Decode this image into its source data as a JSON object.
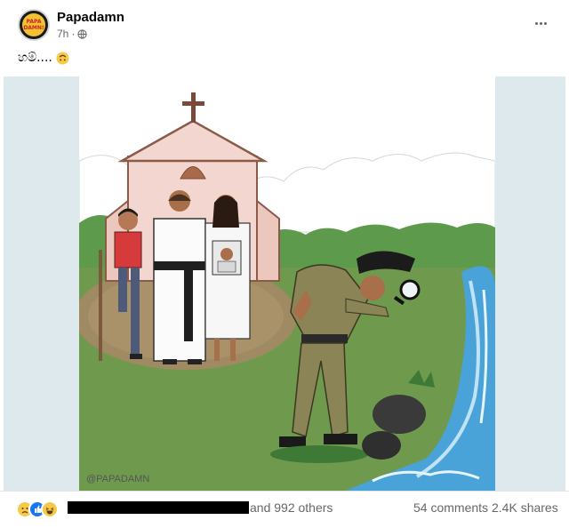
{
  "post": {
    "page_name": "Papadamn",
    "time": "7h",
    "avatar_text": [
      "PAPA",
      "DAMN!"
    ],
    "caption_text": "හම්....",
    "caption_emoji": "upside-down-face",
    "image_signature": "@PAPADAMN",
    "reactions": [
      "sad",
      "like",
      "haha"
    ],
    "reactors_text": "and 992 others",
    "comments_text": "54 comments",
    "shares_text": "2.4K shares",
    "icons": [
      "globe-icon",
      "more-options-icon"
    ],
    "colors": {
      "sky": "#dde9ec",
      "grass": "#6f9a4e",
      "church": "#f2d6cf",
      "police_uniform": "#8a8457",
      "water": "#4aa3d8"
    }
  }
}
